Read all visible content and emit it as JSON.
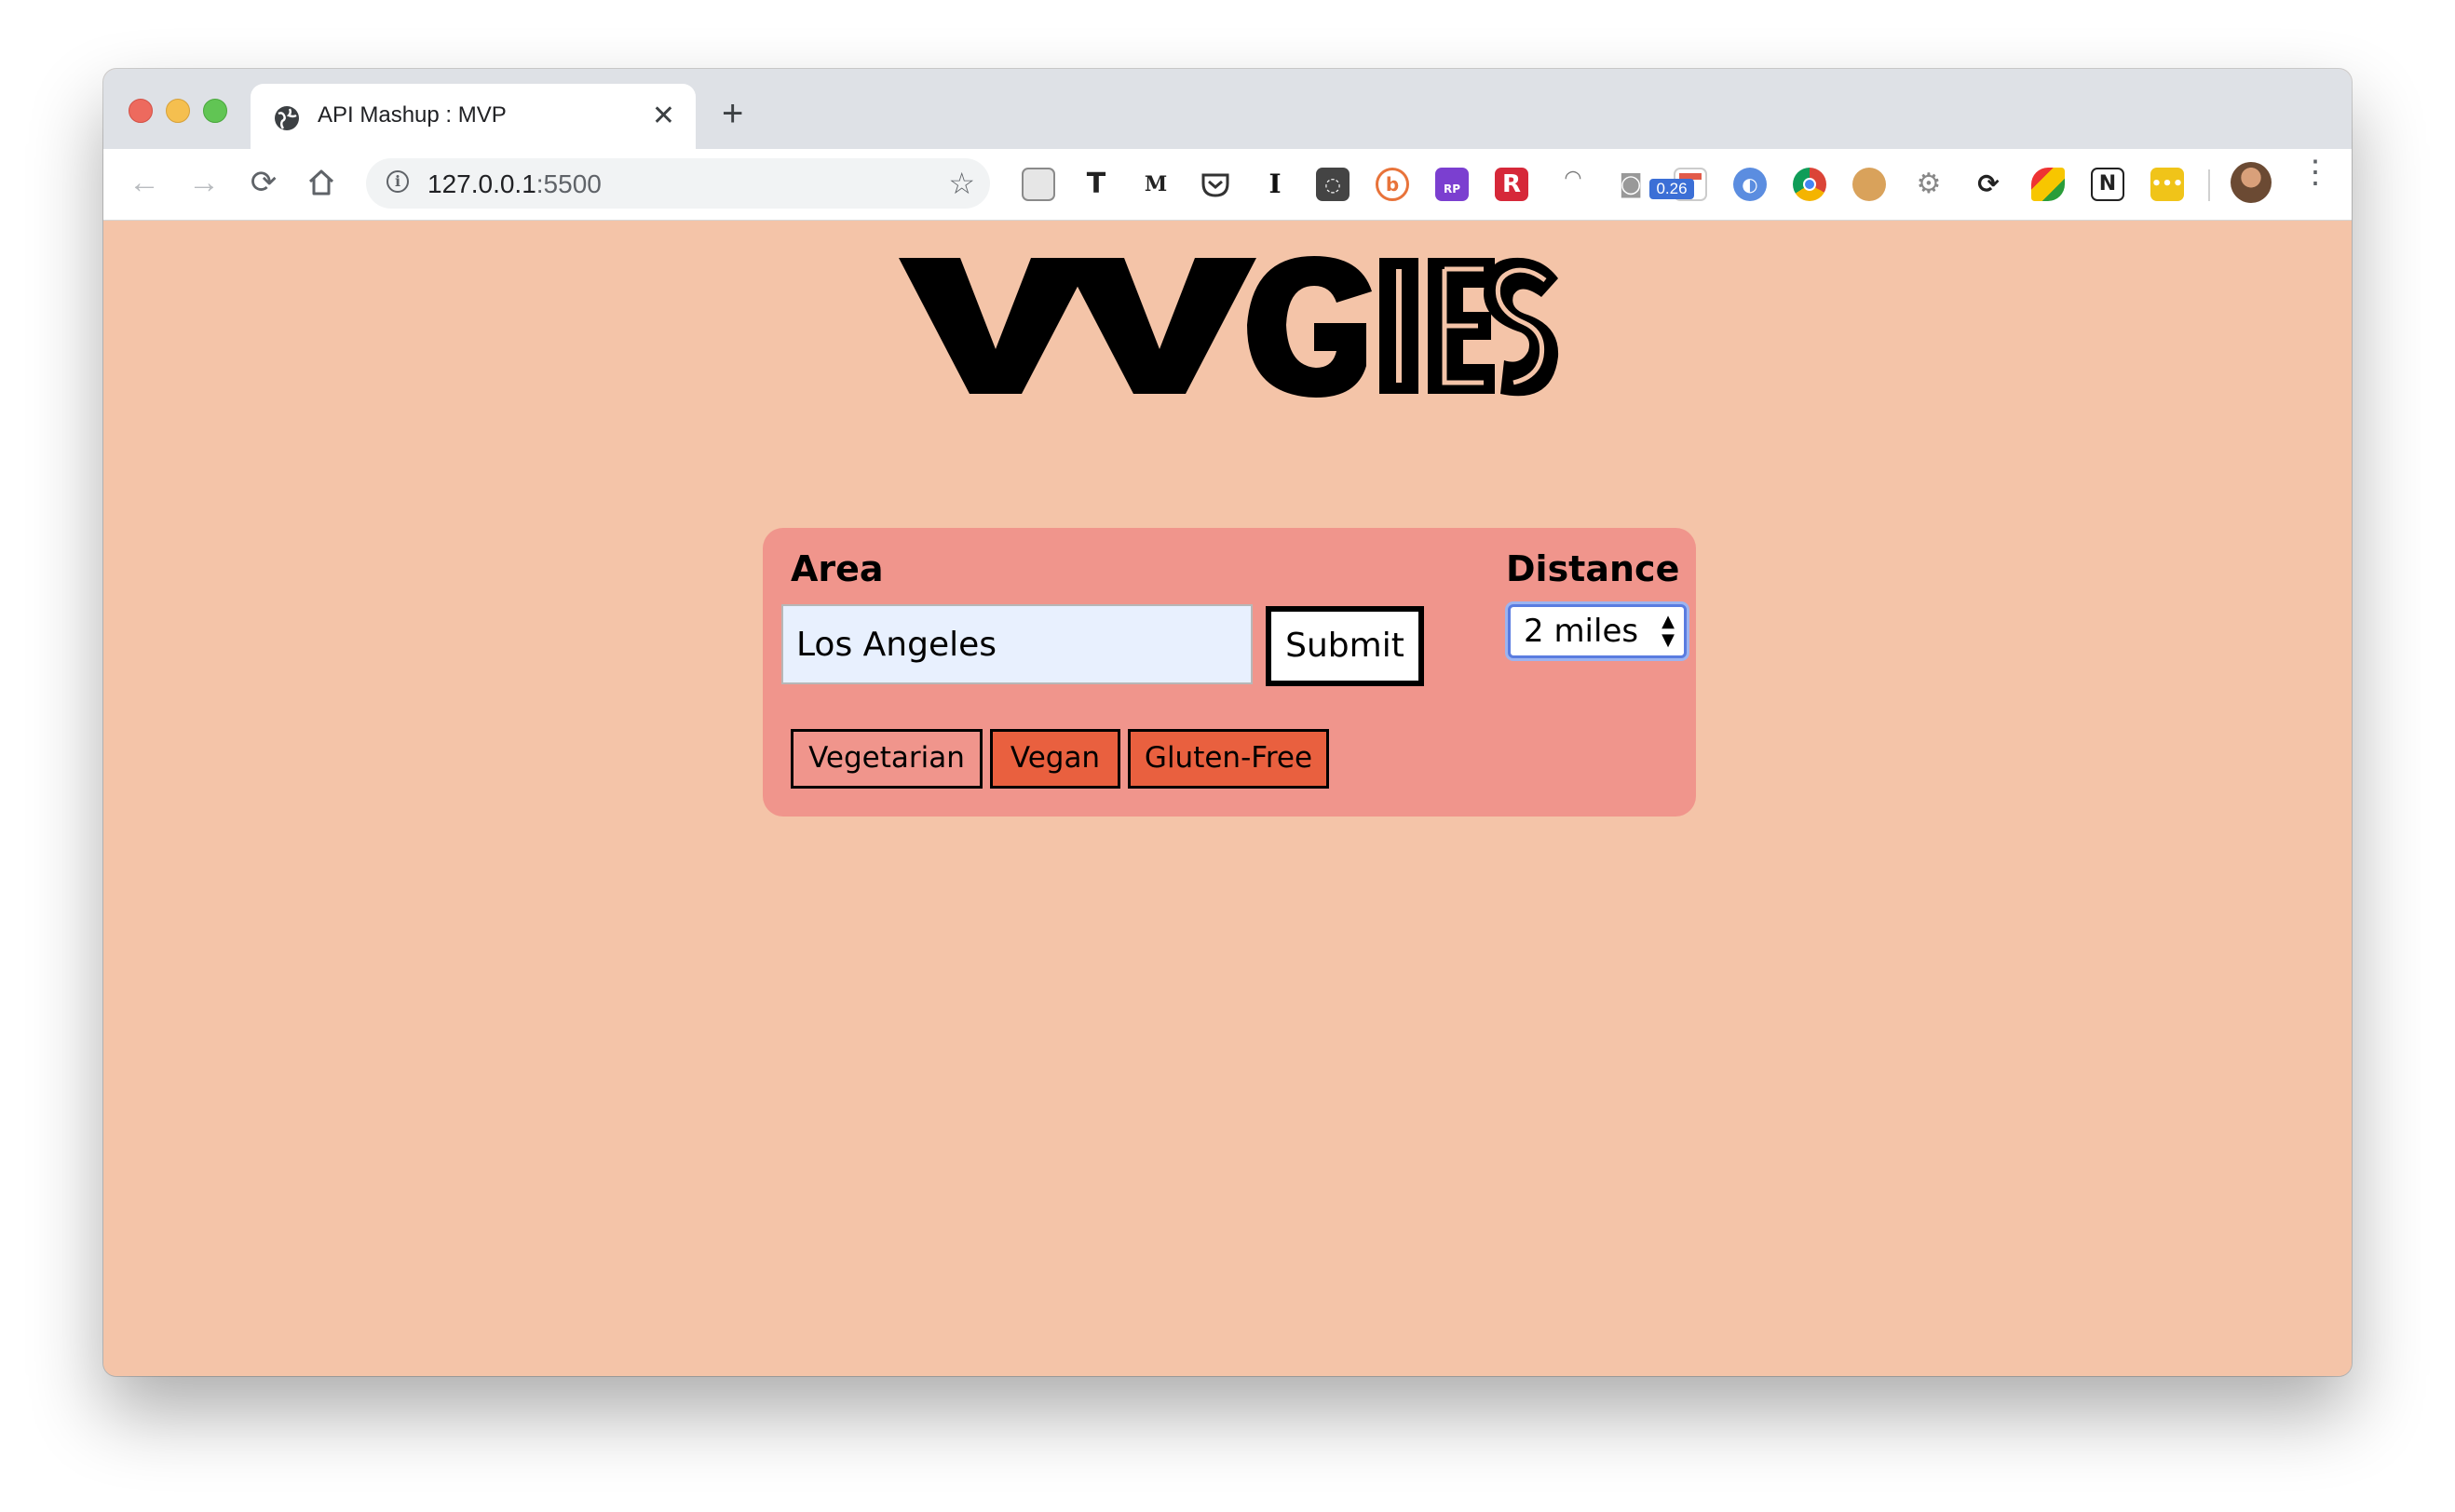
{
  "browser": {
    "tab_title": "API Mashup : MVP",
    "new_tab_symbol": "+",
    "close_symbol": "✕",
    "url_host": "127.0.0.1",
    "url_port": ":5500",
    "extension_badge": "0.26",
    "extensions": [
      "briefcase-icon",
      "typewriter-icon",
      "medium-icon",
      "pocket-icon",
      "instapaper-icon",
      "lightbulb-icon",
      "b-extension-icon",
      "rp-icon",
      "r-extension-icon",
      "speedometer-icon",
      "camera-icon",
      "calendar-icon",
      "compass-icon",
      "chrome-icon",
      "cookie-icon",
      "gear-icon",
      "sync-icon",
      "pen-icon",
      "notion-icon",
      "more-extension-icon"
    ]
  },
  "page": {
    "logo_text": "VVGIES",
    "area_label": "Area",
    "area_value": "Los Angeles",
    "submit_label": "Submit",
    "distance_label": "Distance",
    "distance_value": "2 miles",
    "diet_filters": [
      {
        "label": "Vegetarian",
        "active": false
      },
      {
        "label": "Vegan",
        "active": true
      },
      {
        "label": "Gluten-Free",
        "active": true
      }
    ]
  },
  "colors": {
    "page_bg": "#f4c4a8",
    "card_bg": "#f0958c",
    "active_filter": "#e9603f",
    "input_bg": "#e8f0fe",
    "select_focus": "#5a7ce0"
  }
}
